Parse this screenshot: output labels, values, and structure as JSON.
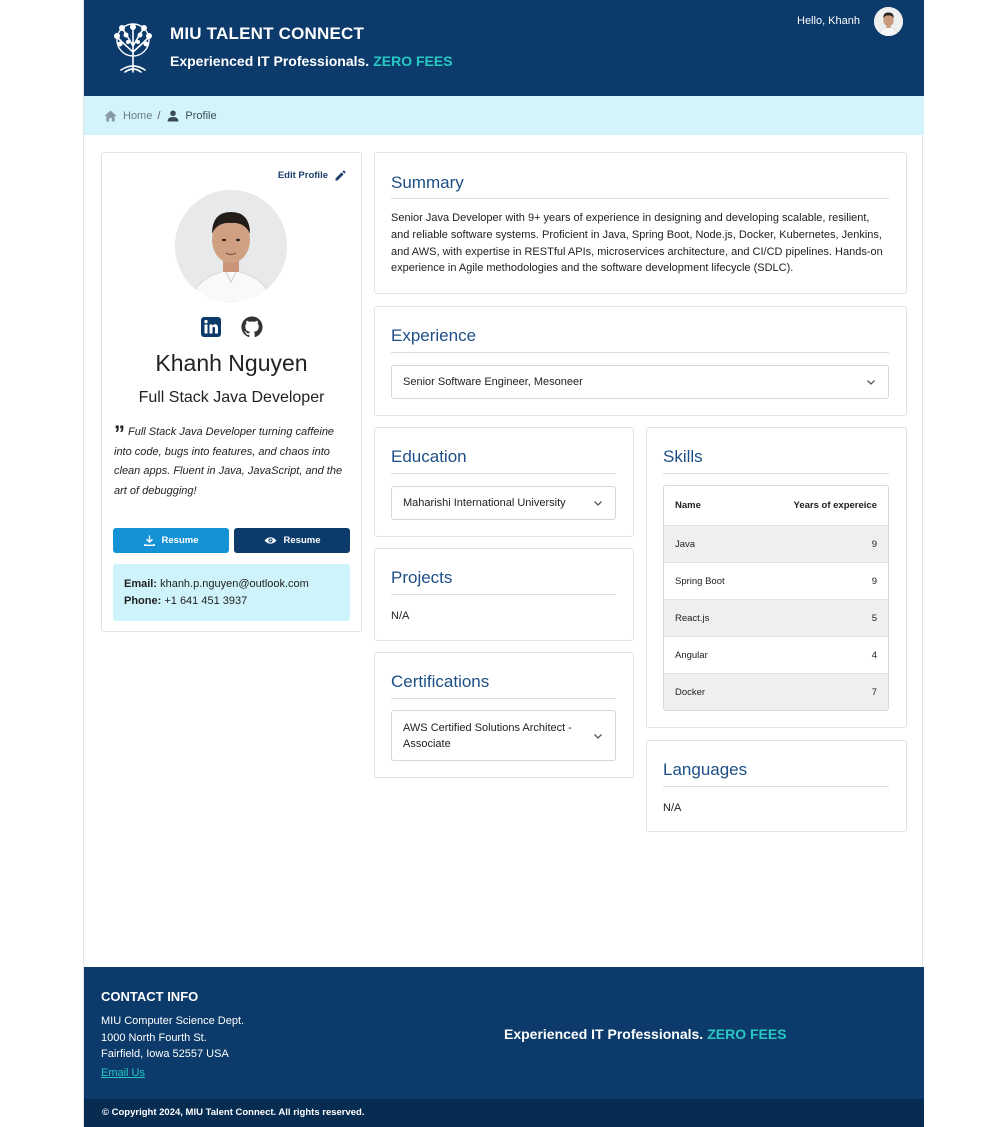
{
  "header": {
    "brand": "MIU TALENT CONNECT",
    "tagline": "Experienced IT Professionals.",
    "tagline_highlight": "ZERO FEES",
    "greeting": "Hello, Khanh"
  },
  "breadcrumb": {
    "home": "Home",
    "separator": "/",
    "current": "Profile"
  },
  "profile": {
    "edit_label": "Edit Profile",
    "name": "Khanh Nguyen",
    "title": "Full Stack Java Developer",
    "quote": "Full Stack Java Developer turning caffeine into code, bugs into features, and chaos into clean apps. Fluent in Java, JavaScript, and the art of debugging!",
    "download_resume_label": "Resume",
    "view_resume_label": "Resume",
    "email_label": "Email:",
    "email": "khanh.p.nguyen@outlook.com",
    "phone_label": "Phone:",
    "phone": "+1 641 451 3937",
    "social_icons": [
      "linkedin-icon",
      "github-icon"
    ]
  },
  "summary": {
    "title": "Summary",
    "text": "Senior Java Developer with 9+ years of experience in designing and developing scalable, resilient, and reliable software systems. Proficient in Java, Spring Boot, Node.js, Docker, Kubernetes, Jenkins, and AWS, with expertise in RESTful APIs, microservices architecture, and CI/CD pipelines. Hands-on experience in Agile methodologies and the software development lifecycle (SDLC)."
  },
  "experience": {
    "title": "Experience",
    "items": [
      "Senior Software Engineer, Mesoneer"
    ]
  },
  "education": {
    "title": "Education",
    "items": [
      "Maharishi International University"
    ]
  },
  "projects": {
    "title": "Projects",
    "empty": "N/A"
  },
  "certifications": {
    "title": "Certifications",
    "items": [
      "AWS Certified Solutions Architect - Associate"
    ]
  },
  "skills": {
    "title": "Skills",
    "columns": [
      "Name",
      "Years of expereice"
    ],
    "rows": [
      [
        "Java",
        "9"
      ],
      [
        "Spring Boot",
        "9"
      ],
      [
        "React.js",
        "5"
      ],
      [
        "Angular",
        "4"
      ],
      [
        "Docker",
        "7"
      ]
    ]
  },
  "languages": {
    "title": "Languages",
    "empty": "N/A"
  },
  "footer": {
    "contact_title": "CONTACT INFO",
    "address_lines": [
      "MIU Computer Science Dept.",
      "1000 North Fourth St.",
      "Fairfield, Iowa 52557 USA"
    ],
    "email_link": "Email Us",
    "tagline": "Experienced IT Professionals.",
    "tagline_highlight": "ZERO FEES",
    "copyright": "© Copyright 2024, MIU Talent Connect. All rights reserved."
  },
  "colors": {
    "header_bg": "#0b3a6b",
    "accent_teal": "#27c9c2",
    "breadcrumb_bg": "#d3f4fb",
    "section_title": "#1d4f86",
    "button_primary": "#1592d6",
    "button_dark": "#0b3a6b"
  }
}
